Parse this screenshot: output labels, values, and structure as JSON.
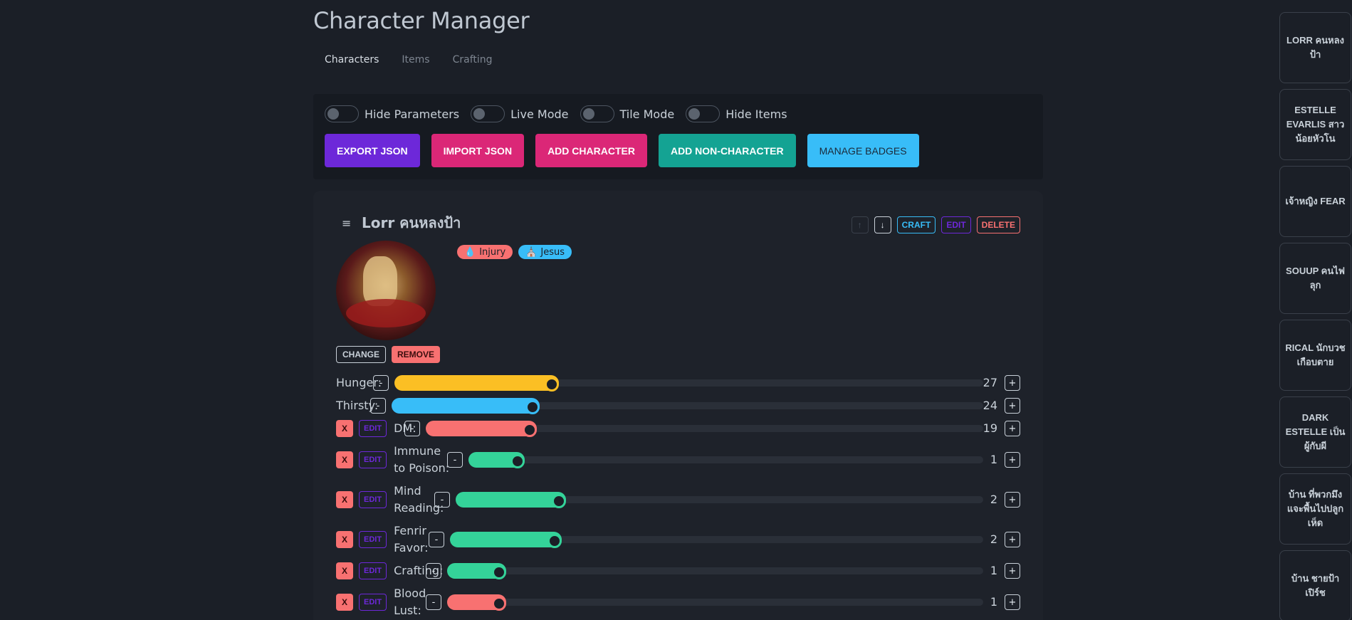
{
  "app": {
    "title": "Character Manager"
  },
  "tabs": [
    {
      "label": "Characters",
      "active": true
    },
    {
      "label": "Items",
      "active": false
    },
    {
      "label": "Crafting",
      "active": false
    }
  ],
  "toggles": [
    {
      "label": "Hide Parameters",
      "on": false
    },
    {
      "label": "Live Mode",
      "on": false
    },
    {
      "label": "Tile Mode",
      "on": false
    },
    {
      "label": "Hide Items",
      "on": false
    }
  ],
  "actions": {
    "export": "EXPORT JSON",
    "import": "IMPORT JSON",
    "add_character": "ADD CHARACTER",
    "add_non_character": "ADD NON-CHARACTER",
    "manage_badges": "MANAGE BADGES"
  },
  "character": {
    "menu_icon": "≡",
    "name": "Lorr คนหลงป้า",
    "up": "↑",
    "down": "↓",
    "craft": "CRAFT",
    "edit": "EDIT",
    "delete": "DELETE",
    "badges": [
      {
        "label": "Injury",
        "icon": "💧",
        "color": "#f87171"
      },
      {
        "label": "Jesus",
        "icon": "⛪",
        "color": "#38bdf8"
      }
    ],
    "change": "CHANGE",
    "remove": "REMOVE",
    "stats": [
      {
        "label": "Hunger:",
        "value": 27,
        "fill": 0.28,
        "color": "#fbbf24",
        "custom": false
      },
      {
        "label": "Thirsty:",
        "value": 24,
        "fill": 0.25,
        "color": "#38bdf8",
        "custom": false
      },
      {
        "label": "DM:",
        "value": 19,
        "fill": 0.2,
        "color": "#f87171",
        "custom": true
      },
      {
        "label": "Immune to Poison:",
        "value": 1,
        "fill": 0.11,
        "color": "#34d399",
        "custom": true
      },
      {
        "label": "Mind Reading:",
        "value": 2,
        "fill": 0.21,
        "color": "#34d399",
        "custom": true
      },
      {
        "label": "Fenrir Favor:",
        "value": 2,
        "fill": 0.21,
        "color": "#34d399",
        "custom": true
      },
      {
        "label": "Crafting:",
        "value": 1,
        "fill": 0.11,
        "color": "#34d399",
        "custom": true
      },
      {
        "label": "Blood Lust:",
        "value": 1,
        "fill": 0.11,
        "color": "#f87171",
        "custom": true
      }
    ],
    "x_label": "X",
    "stat_edit": "EDIT",
    "minus": "-",
    "plus": "+"
  },
  "sidebar_characters": [
    "LORR คนหลงป้า",
    "ESTELLE EVARLIS สาวน้อยหัวโน",
    "เจ้าหญิง FEAR",
    "SOUUP คนไฟลุก",
    "RICAL นักบวชเกือบตาย",
    "DARK ESTELLE เป็นผู้กับผี",
    "บ้าน ที่พวกมึงแจะพื้นไปปลูกเห็ด",
    "บ้าน ชายป้าเปิร์ช"
  ]
}
